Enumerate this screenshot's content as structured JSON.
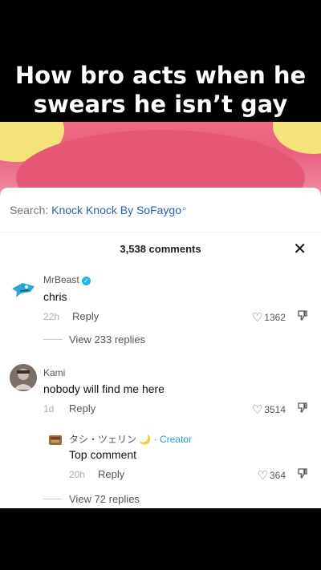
{
  "caption": {
    "line1": "How bro acts when he",
    "line2": "swears he isn’t gay"
  },
  "search": {
    "prefix": "Search: ",
    "term": "Knock Knock By SoFaygo",
    "icon": "search-icon"
  },
  "comments_header": {
    "count_label": "3,538 comments",
    "close_icon": "close-icon"
  },
  "comments": [
    {
      "author": "MrBeast",
      "verified": true,
      "text": "chris",
      "time": "22h",
      "reply_label": "Reply",
      "likes": "1362",
      "view_replies": "View 233 replies"
    },
    {
      "author": "Kami",
      "text": "nobody will find me here",
      "time": "1d",
      "reply_label": "Reply",
      "likes": "3514"
    }
  ],
  "reply": {
    "author": "タシ・ツェリン 🌙",
    "creator_label": " · Creator",
    "text": "Top comment",
    "time": "20h",
    "reply_label": "Reply",
    "likes": "364"
  },
  "view_more_replies": "View 72 replies"
}
